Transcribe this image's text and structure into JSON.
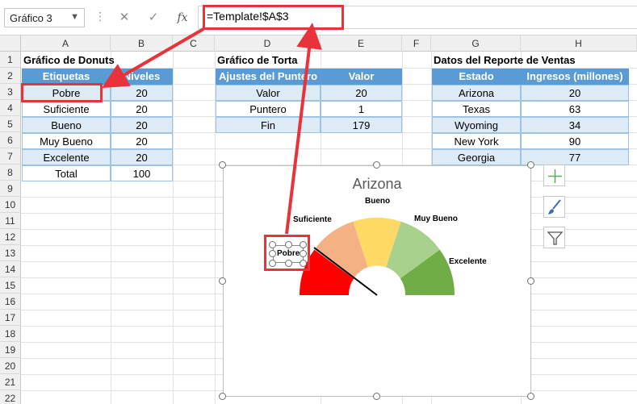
{
  "formula_bar": {
    "name_box": "Gráfico 3",
    "formula": "=Template!$A$3"
  },
  "columns": [
    "A",
    "B",
    "C",
    "D",
    "E",
    "F",
    "G",
    "H"
  ],
  "rows": [
    "1",
    "2",
    "3",
    "4",
    "5",
    "6",
    "7",
    "8",
    "9",
    "10",
    "11",
    "12",
    "13",
    "14",
    "15",
    "16",
    "17",
    "18",
    "19",
    "20",
    "21",
    "22"
  ],
  "donut_table": {
    "title": "Gráfico de Donuts",
    "headers": [
      "Etiquetas",
      "Niveles"
    ],
    "rows": [
      [
        "Pobre",
        "20"
      ],
      [
        "Suficiente",
        "20"
      ],
      [
        "Bueno",
        "20"
      ],
      [
        "Muy Bueno",
        "20"
      ],
      [
        "Excelente",
        "20"
      ],
      [
        "Total",
        "100"
      ]
    ]
  },
  "pie_table": {
    "title": "Gráfico de Torta",
    "headers": [
      "Ajustes del Puntero",
      "Valor"
    ],
    "rows": [
      [
        "Valor",
        "20"
      ],
      [
        "Puntero",
        "1"
      ],
      [
        "Fin",
        "179"
      ]
    ]
  },
  "sales_table": {
    "title": "Datos del Reporte de Ventas",
    "headers": [
      "Estado",
      "Ingresos (millones)"
    ],
    "rows": [
      [
        "Arizona",
        "20"
      ],
      [
        "Texas",
        "63"
      ],
      [
        "Wyoming",
        "34"
      ],
      [
        "New York",
        "90"
      ],
      [
        "Georgia",
        "77"
      ]
    ]
  },
  "chart": {
    "title": "Arizona",
    "segment_labels": [
      "Suficiente",
      "Bueno",
      "Muy Bueno",
      "Excelente"
    ],
    "pointer_label": "Pobre",
    "segment_colors": [
      "#ff0000",
      "#f4b183",
      "#ffd966",
      "#a9d18e",
      "#70ad47"
    ]
  },
  "side_buttons": [
    "chart-elements-plus-icon",
    "chart-styles-brush-icon",
    "chart-filters-funnel-icon"
  ],
  "accent": "#e8333a",
  "header_blue": "#5b9bd5",
  "band_blue": "#ddebf7"
}
